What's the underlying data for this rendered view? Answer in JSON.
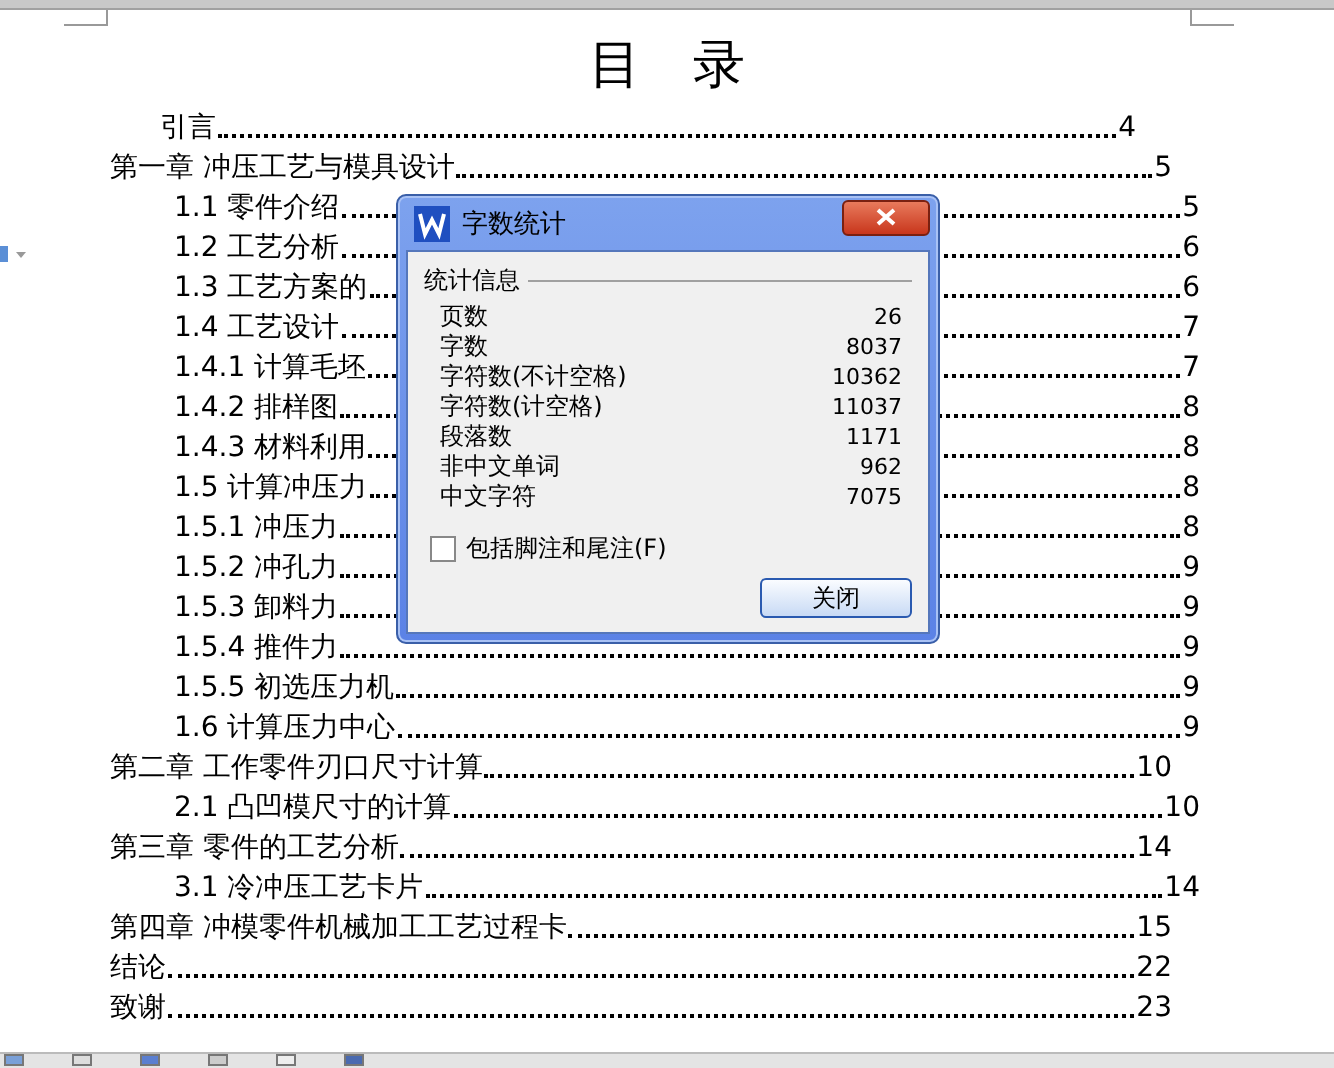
{
  "document": {
    "title": "目 录",
    "toc": [
      {
        "kind": "front",
        "text": "引言",
        "page": "4"
      },
      {
        "kind": "chapter",
        "text": "第一章 冲压工艺与模具设计",
        "page": "5"
      },
      {
        "kind": "section",
        "text": "1.1 零件介绍",
        "page": "5"
      },
      {
        "kind": "section",
        "text": "1.2 工艺分析",
        "page": "6"
      },
      {
        "kind": "section",
        "text": "1.3 工艺方案的",
        "page": "6"
      },
      {
        "kind": "section",
        "text": "1.4 工艺设计",
        "page": "7"
      },
      {
        "kind": "section",
        "text": "1.4.1 计算毛坯",
        "page": "7"
      },
      {
        "kind": "section",
        "text": "1.4.2 排样图",
        "page": "8"
      },
      {
        "kind": "section",
        "text": "1.4.3 材料利用",
        "page": "8"
      },
      {
        "kind": "section",
        "text": "1.5 计算冲压力",
        "page": "8"
      },
      {
        "kind": "section",
        "text": "1.5.1 冲压力",
        "page": "8"
      },
      {
        "kind": "section",
        "text": "1.5.2 冲孔力",
        "page": "9"
      },
      {
        "kind": "section",
        "text": "1.5.3 卸料力",
        "page": "9"
      },
      {
        "kind": "section",
        "text": "1.5.4 推件力",
        "page": "9"
      },
      {
        "kind": "section",
        "text": "1.5.5 初选压力机",
        "page": "9"
      },
      {
        "kind": "section",
        "text": "1.6 计算压力中心",
        "page": "9"
      },
      {
        "kind": "chapter",
        "text": "第二章 工作零件刃口尺寸计算",
        "page": "10"
      },
      {
        "kind": "section",
        "text": "2.1 凸凹模尺寸的计算",
        "page": "10"
      },
      {
        "kind": "chapter",
        "text": "第三章 零件的工艺分析",
        "page": "14"
      },
      {
        "kind": "section",
        "text": "3.1 冷冲压工艺卡片",
        "page": "14"
      },
      {
        "kind": "chapter",
        "text": "第四章 冲模零件机械加工工艺过程卡",
        "page": "15"
      },
      {
        "kind": "chapter",
        "text": "结论",
        "page": "22"
      },
      {
        "kind": "chapter",
        "text": "致谢",
        "page": "23"
      }
    ]
  },
  "dialog": {
    "title": "字数统计",
    "group_title": "统计信息",
    "stats": [
      {
        "label": "页数",
        "value": "26"
      },
      {
        "label": "字数",
        "value": "8037"
      },
      {
        "label": "字符数(不计空格)",
        "value": "10362"
      },
      {
        "label": "字符数(计空格)",
        "value": "11037"
      },
      {
        "label": "段落数",
        "value": "1171"
      },
      {
        "label": "非中文单词",
        "value": "962"
      },
      {
        "label": "中文字符",
        "value": "7075"
      }
    ],
    "checkbox": {
      "label": "包括脚注和尾注(F)",
      "checked": false
    },
    "button": "关闭"
  }
}
